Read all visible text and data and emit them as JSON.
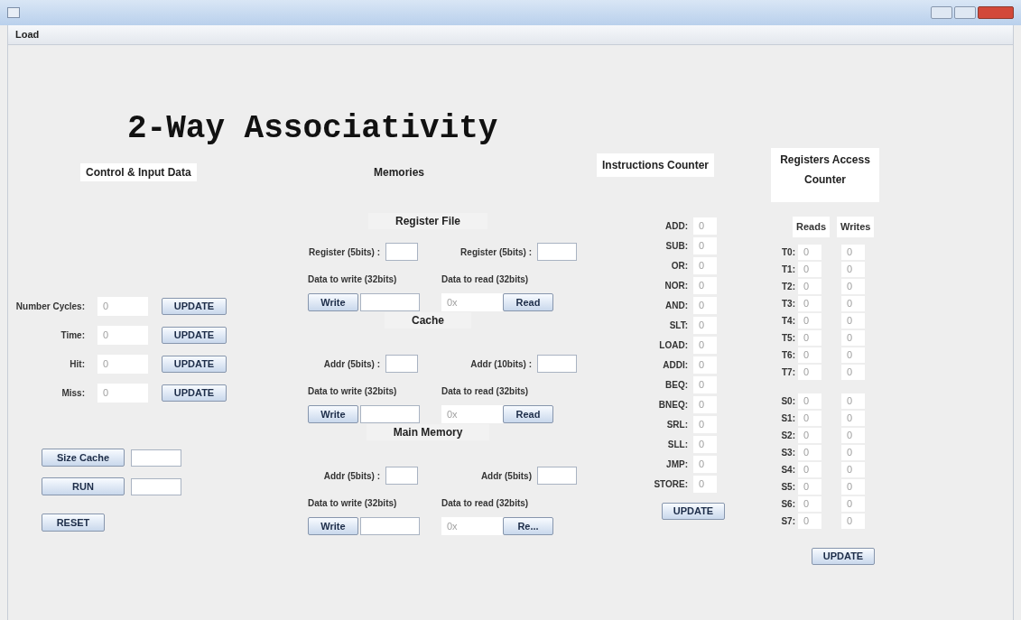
{
  "menu": [
    {
      "label": "Load"
    }
  ],
  "title": "2-Way Associativity",
  "control": {
    "heading": "Control & Input Data",
    "stats": [
      {
        "label": "Number Cycles:",
        "value": "0",
        "button": "UPDATE"
      },
      {
        "label": "Time:",
        "value": "0",
        "button": "UPDATE"
      },
      {
        "label": "Hit:",
        "value": "0",
        "button": "UPDATE"
      },
      {
        "label": "Miss:",
        "value": "0",
        "button": "UPDATE"
      }
    ],
    "actions": [
      {
        "kind": "button_field",
        "button": "Size Cache"
      },
      {
        "kind": "button_field",
        "button": "RUN"
      },
      {
        "kind": "button",
        "button": "RESET"
      }
    ]
  },
  "memories": {
    "heading": "Memories",
    "sections": [
      {
        "title": "Register File",
        "addr_left": "Register (5bits) :",
        "addr_right": "Register (5bits) :",
        "write_label": "Data to write (32bits)",
        "read_label": "Data to read (32bits)",
        "write_button": "Write",
        "read_value": "0x",
        "read_button": "Read"
      },
      {
        "title": "Cache",
        "addr_left": "Addr (5bits) :",
        "addr_right": "Addr (10bits) :",
        "write_label": "Data to write (32bits)",
        "read_label": "Data to read (32bits)",
        "write_button": "Write",
        "read_value": "0x",
        "read_button": "Read"
      },
      {
        "title": "Main Memory",
        "addr_left": "Addr (5bits) :",
        "addr_right": "Addr (5bits)",
        "write_label": "Data to write (32bits)",
        "read_label": "Data to read (32bits)",
        "write_button": "Write",
        "read_value": "0x",
        "read_button": "Re..."
      }
    ]
  },
  "instructions": {
    "heading": "Instructions Counter",
    "items": [
      {
        "label": "ADD:",
        "value": "0"
      },
      {
        "label": "SUB:",
        "value": "0"
      },
      {
        "label": "OR:",
        "value": "0"
      },
      {
        "label": "NOR:",
        "value": "0"
      },
      {
        "label": "AND:",
        "value": "0"
      },
      {
        "label": "SLT:",
        "value": "0"
      },
      {
        "label": "LOAD:",
        "value": "0"
      },
      {
        "label": "ADDI:",
        "value": "0"
      },
      {
        "label": "BEQ:",
        "value": "0"
      },
      {
        "label": "BNEQ:",
        "value": "0"
      },
      {
        "label": "SRL:",
        "value": "0"
      },
      {
        "label": "SLL:",
        "value": "0"
      },
      {
        "label": "JMP:",
        "value": "0"
      },
      {
        "label": "STORE:",
        "value": "0"
      }
    ],
    "button": "UPDATE"
  },
  "registers": {
    "heading": "Registers Access Counter",
    "columns": [
      "Reads",
      "Writes"
    ],
    "groups": [
      [
        {
          "label": "T0:",
          "reads": "0",
          "writes": "0"
        },
        {
          "label": "T1:",
          "reads": "0",
          "writes": "0"
        },
        {
          "label": "T2:",
          "reads": "0",
          "writes": "0"
        },
        {
          "label": "T3:",
          "reads": "0",
          "writes": "0"
        },
        {
          "label": "T4:",
          "reads": "0",
          "writes": "0"
        },
        {
          "label": "T5:",
          "reads": "0",
          "writes": "0"
        },
        {
          "label": "T6:",
          "reads": "0",
          "writes": "0"
        },
        {
          "label": "T7:",
          "reads": "0",
          "writes": "0"
        }
      ],
      [
        {
          "label": "S0:",
          "reads": "0",
          "writes": "0"
        },
        {
          "label": "S1:",
          "reads": "0",
          "writes": "0"
        },
        {
          "label": "S2:",
          "reads": "0",
          "writes": "0"
        },
        {
          "label": "S3:",
          "reads": "0",
          "writes": "0"
        },
        {
          "label": "S4:",
          "reads": "0",
          "writes": "0"
        },
        {
          "label": "S5:",
          "reads": "0",
          "writes": "0"
        },
        {
          "label": "S6:",
          "reads": "0",
          "writes": "0"
        },
        {
          "label": "S7:",
          "reads": "0",
          "writes": "0"
        }
      ]
    ],
    "button": "UPDATE"
  }
}
